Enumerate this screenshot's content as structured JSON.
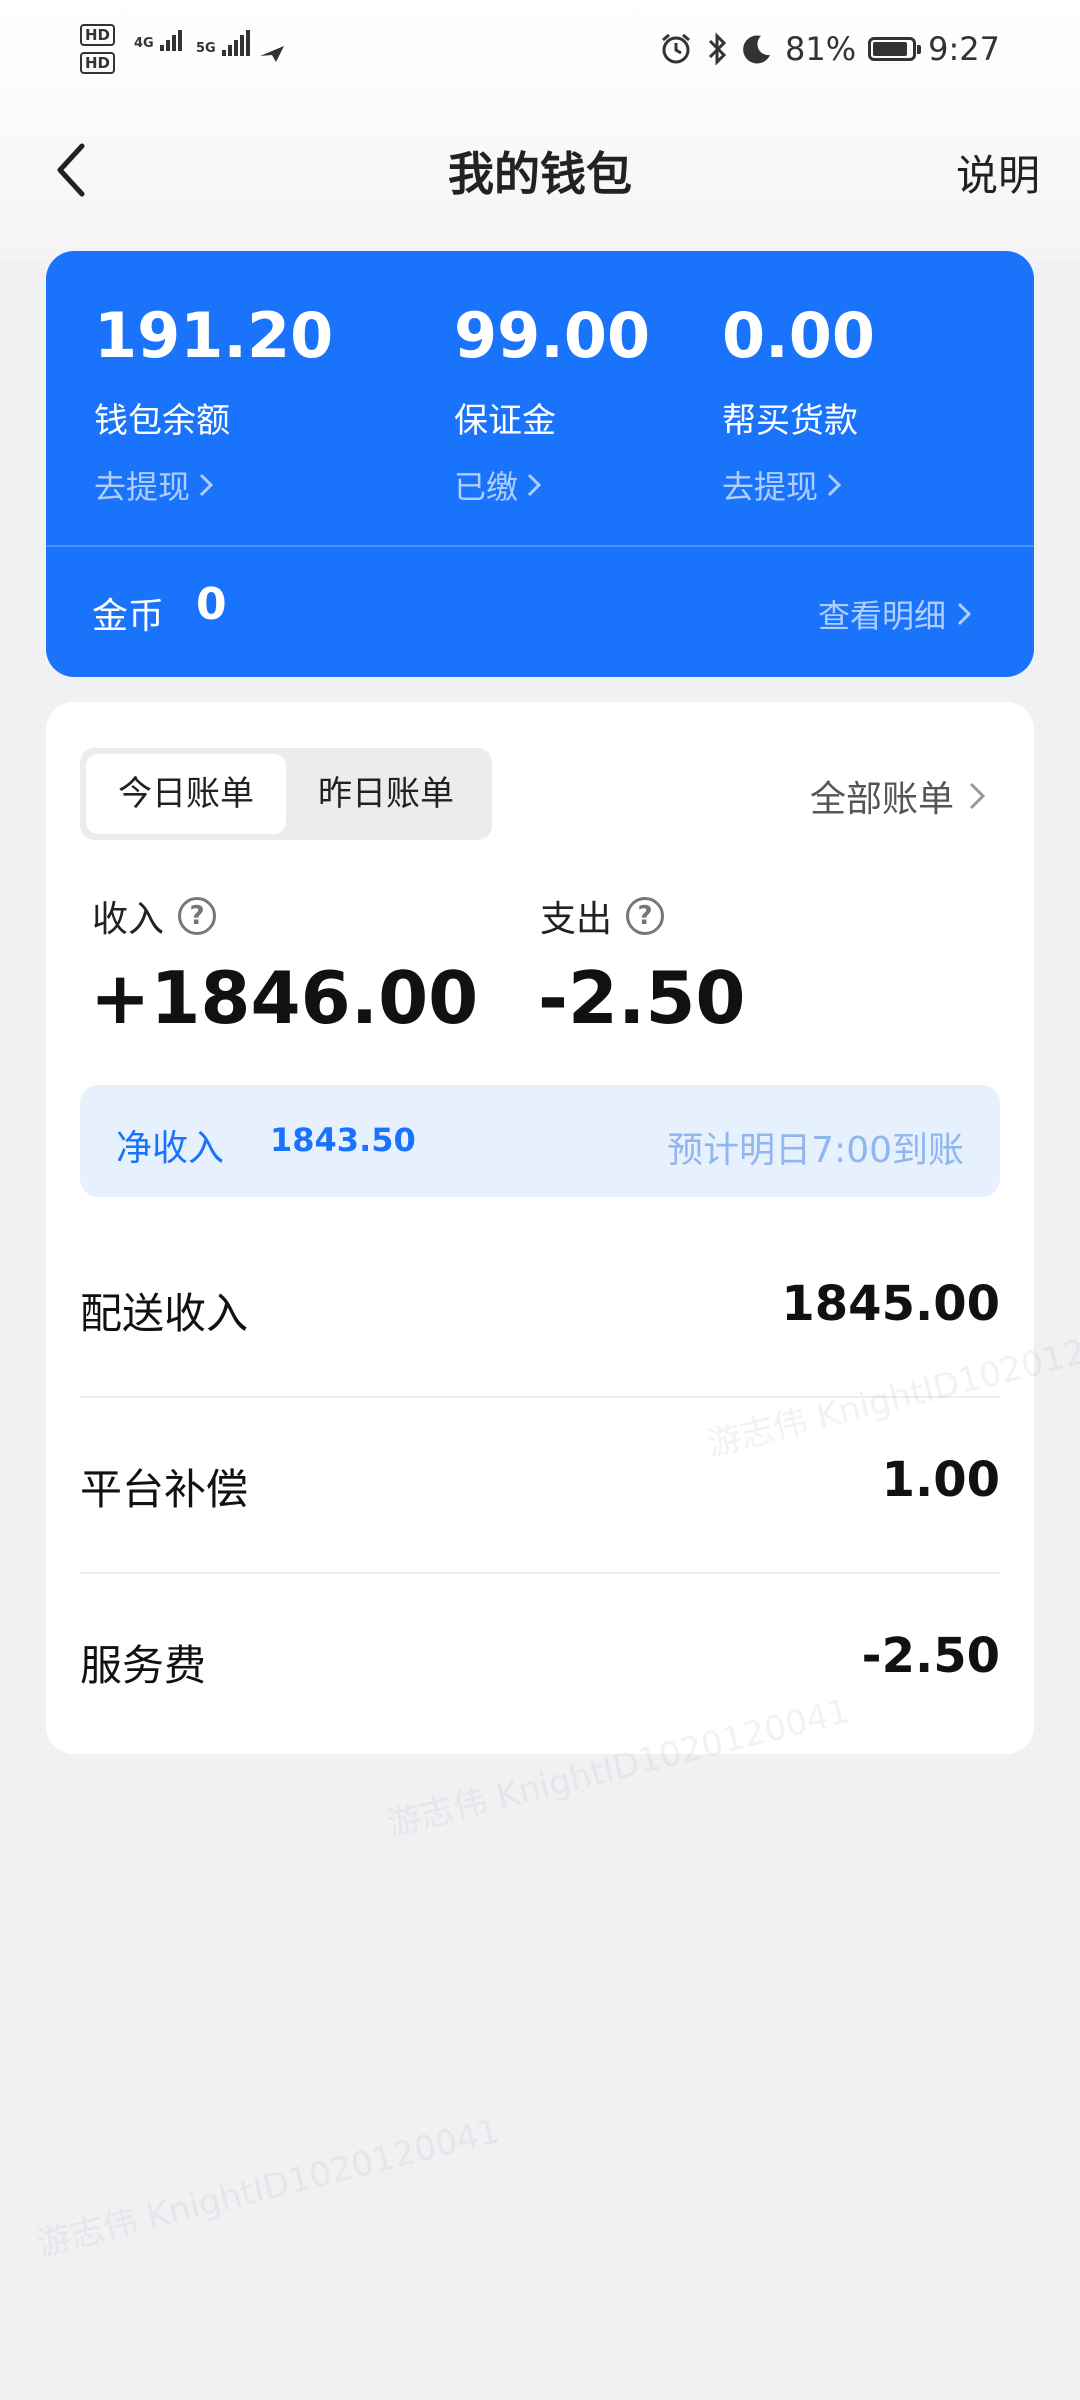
{
  "status_bar": {
    "hd1": "HD",
    "hd2": "HD",
    "sim1": "4G",
    "sim2": "5G",
    "battery": "81%",
    "time": "9:27"
  },
  "nav": {
    "title": "我的钱包",
    "help": "说明"
  },
  "wallet": {
    "balance": {
      "amount": "191.20",
      "label": "钱包余额",
      "action": "去提现"
    },
    "deposit": {
      "amount": "99.00",
      "label": "保证金",
      "action": "已缴"
    },
    "purchase": {
      "amount": "0.00",
      "label": "帮买货款",
      "action": "去提现"
    },
    "coins_label": "金币",
    "coins_value": "0",
    "detail": "查看明细"
  },
  "bills": {
    "tabs": [
      "今日账单",
      "昨日账单"
    ],
    "active_tab": 0,
    "all_bills": "全部账单",
    "income_label": "收入",
    "income_value": "+1846.00",
    "expense_label": "支出",
    "expense_value": "-2.50",
    "net_label": "净收入",
    "net_value": "1843.50",
    "net_eta": "预计明日7:00到账",
    "items": [
      {
        "name": "配送收入",
        "value": "1845.00"
      },
      {
        "name": "平台补偿",
        "value": "1.00"
      },
      {
        "name": "服务费",
        "value": "-2.50"
      }
    ]
  },
  "watermark": "游志伟 KnightID1020120041",
  "colors": {
    "accent": "#1a73fb",
    "net_bg": "#e7f1fd"
  }
}
